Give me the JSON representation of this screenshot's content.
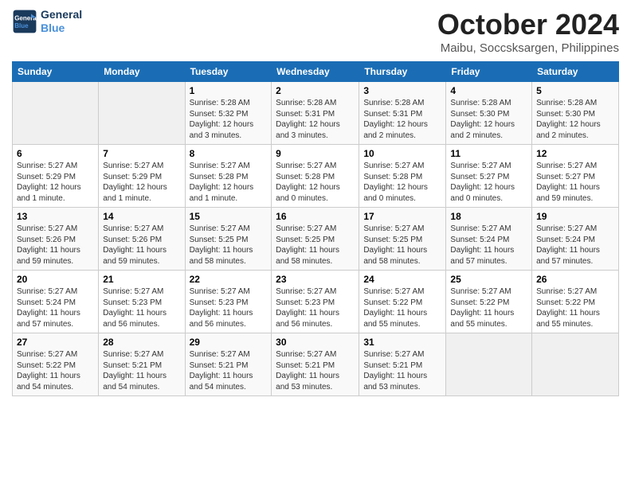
{
  "logo": {
    "line1": "General",
    "line2": "Blue"
  },
  "title": "October 2024",
  "location": "Maibu, Soccsksargen, Philippines",
  "days_of_week": [
    "Sunday",
    "Monday",
    "Tuesday",
    "Wednesday",
    "Thursday",
    "Friday",
    "Saturday"
  ],
  "weeks": [
    [
      {
        "day": "",
        "empty": true
      },
      {
        "day": "",
        "empty": true
      },
      {
        "day": "1",
        "sunrise": "5:28 AM",
        "sunset": "5:32 PM",
        "daylight": "12 hours and 3 minutes."
      },
      {
        "day": "2",
        "sunrise": "5:28 AM",
        "sunset": "5:31 PM",
        "daylight": "12 hours and 3 minutes."
      },
      {
        "day": "3",
        "sunrise": "5:28 AM",
        "sunset": "5:31 PM",
        "daylight": "12 hours and 2 minutes."
      },
      {
        "day": "4",
        "sunrise": "5:28 AM",
        "sunset": "5:30 PM",
        "daylight": "12 hours and 2 minutes."
      },
      {
        "day": "5",
        "sunrise": "5:28 AM",
        "sunset": "5:30 PM",
        "daylight": "12 hours and 2 minutes."
      }
    ],
    [
      {
        "day": "6",
        "sunrise": "5:27 AM",
        "sunset": "5:29 PM",
        "daylight": "12 hours and 1 minute."
      },
      {
        "day": "7",
        "sunrise": "5:27 AM",
        "sunset": "5:29 PM",
        "daylight": "12 hours and 1 minute."
      },
      {
        "day": "8",
        "sunrise": "5:27 AM",
        "sunset": "5:28 PM",
        "daylight": "12 hours and 1 minute."
      },
      {
        "day": "9",
        "sunrise": "5:27 AM",
        "sunset": "5:28 PM",
        "daylight": "12 hours and 0 minutes."
      },
      {
        "day": "10",
        "sunrise": "5:27 AM",
        "sunset": "5:28 PM",
        "daylight": "12 hours and 0 minutes."
      },
      {
        "day": "11",
        "sunrise": "5:27 AM",
        "sunset": "5:27 PM",
        "daylight": "12 hours and 0 minutes."
      },
      {
        "day": "12",
        "sunrise": "5:27 AM",
        "sunset": "5:27 PM",
        "daylight": "11 hours and 59 minutes."
      }
    ],
    [
      {
        "day": "13",
        "sunrise": "5:27 AM",
        "sunset": "5:26 PM",
        "daylight": "11 hours and 59 minutes."
      },
      {
        "day": "14",
        "sunrise": "5:27 AM",
        "sunset": "5:26 PM",
        "daylight": "11 hours and 59 minutes."
      },
      {
        "day": "15",
        "sunrise": "5:27 AM",
        "sunset": "5:25 PM",
        "daylight": "11 hours and 58 minutes."
      },
      {
        "day": "16",
        "sunrise": "5:27 AM",
        "sunset": "5:25 PM",
        "daylight": "11 hours and 58 minutes."
      },
      {
        "day": "17",
        "sunrise": "5:27 AM",
        "sunset": "5:25 PM",
        "daylight": "11 hours and 58 minutes."
      },
      {
        "day": "18",
        "sunrise": "5:27 AM",
        "sunset": "5:24 PM",
        "daylight": "11 hours and 57 minutes."
      },
      {
        "day": "19",
        "sunrise": "5:27 AM",
        "sunset": "5:24 PM",
        "daylight": "11 hours and 57 minutes."
      }
    ],
    [
      {
        "day": "20",
        "sunrise": "5:27 AM",
        "sunset": "5:24 PM",
        "daylight": "11 hours and 57 minutes."
      },
      {
        "day": "21",
        "sunrise": "5:27 AM",
        "sunset": "5:23 PM",
        "daylight": "11 hours and 56 minutes."
      },
      {
        "day": "22",
        "sunrise": "5:27 AM",
        "sunset": "5:23 PM",
        "daylight": "11 hours and 56 minutes."
      },
      {
        "day": "23",
        "sunrise": "5:27 AM",
        "sunset": "5:23 PM",
        "daylight": "11 hours and 56 minutes."
      },
      {
        "day": "24",
        "sunrise": "5:27 AM",
        "sunset": "5:22 PM",
        "daylight": "11 hours and 55 minutes."
      },
      {
        "day": "25",
        "sunrise": "5:27 AM",
        "sunset": "5:22 PM",
        "daylight": "11 hours and 55 minutes."
      },
      {
        "day": "26",
        "sunrise": "5:27 AM",
        "sunset": "5:22 PM",
        "daylight": "11 hours and 55 minutes."
      }
    ],
    [
      {
        "day": "27",
        "sunrise": "5:27 AM",
        "sunset": "5:22 PM",
        "daylight": "11 hours and 54 minutes."
      },
      {
        "day": "28",
        "sunrise": "5:27 AM",
        "sunset": "5:21 PM",
        "daylight": "11 hours and 54 minutes."
      },
      {
        "day": "29",
        "sunrise": "5:27 AM",
        "sunset": "5:21 PM",
        "daylight": "11 hours and 54 minutes."
      },
      {
        "day": "30",
        "sunrise": "5:27 AM",
        "sunset": "5:21 PM",
        "daylight": "11 hours and 53 minutes."
      },
      {
        "day": "31",
        "sunrise": "5:27 AM",
        "sunset": "5:21 PM",
        "daylight": "11 hours and 53 minutes."
      },
      {
        "day": "",
        "empty": true
      },
      {
        "day": "",
        "empty": true
      }
    ]
  ]
}
